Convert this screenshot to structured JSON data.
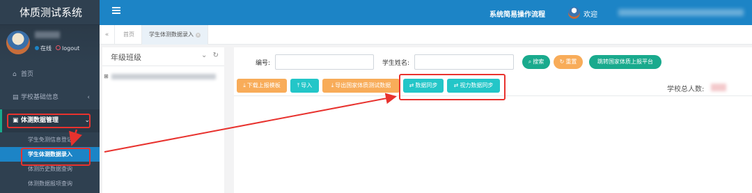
{
  "app": {
    "title": "体质测试系统"
  },
  "profile": {
    "online_label": "在线",
    "logout_label": "logout"
  },
  "sidebar": {
    "items": [
      {
        "icon": "home-icon",
        "label": "首页"
      },
      {
        "icon": "bank-icon",
        "label": "学校基础信息"
      },
      {
        "icon": "id-card-icon",
        "label": "体测数据管理"
      }
    ],
    "subitems": [
      {
        "label": "学生免测信息登记"
      },
      {
        "label": "学生体测数据录入"
      },
      {
        "label": "体测历史数据查询"
      },
      {
        "label": "体测数据报项查询"
      }
    ]
  },
  "topbar": {
    "process_label": "系统简易操作流程",
    "welcome_label": "欢迎"
  },
  "tabs": {
    "home": "首页",
    "current": "学生体测数据录入"
  },
  "grade_panel": {
    "title": "年级班级"
  },
  "search": {
    "id_label": "编号:",
    "id_value": "",
    "name_label": "学生姓名:",
    "name_value": "",
    "search_button": "搜索",
    "reset_button": "重置",
    "report_button": "跳转国家体质上报平台"
  },
  "toolbar": {
    "download_template": "下载上报模板",
    "import": "导入",
    "export_national": "导出国家体质测试数据",
    "data_sync": "数据同步",
    "vision_sync": "视力数据同步",
    "total_label": "学校总人数:"
  },
  "colors": {
    "sidebar_bg": "#2f4050",
    "topbar_bg": "#1c84c6",
    "teal": "#19aa8d",
    "orange": "#f8ac59",
    "cyan": "#23c6c8",
    "annotation_red": "#e8322e"
  }
}
